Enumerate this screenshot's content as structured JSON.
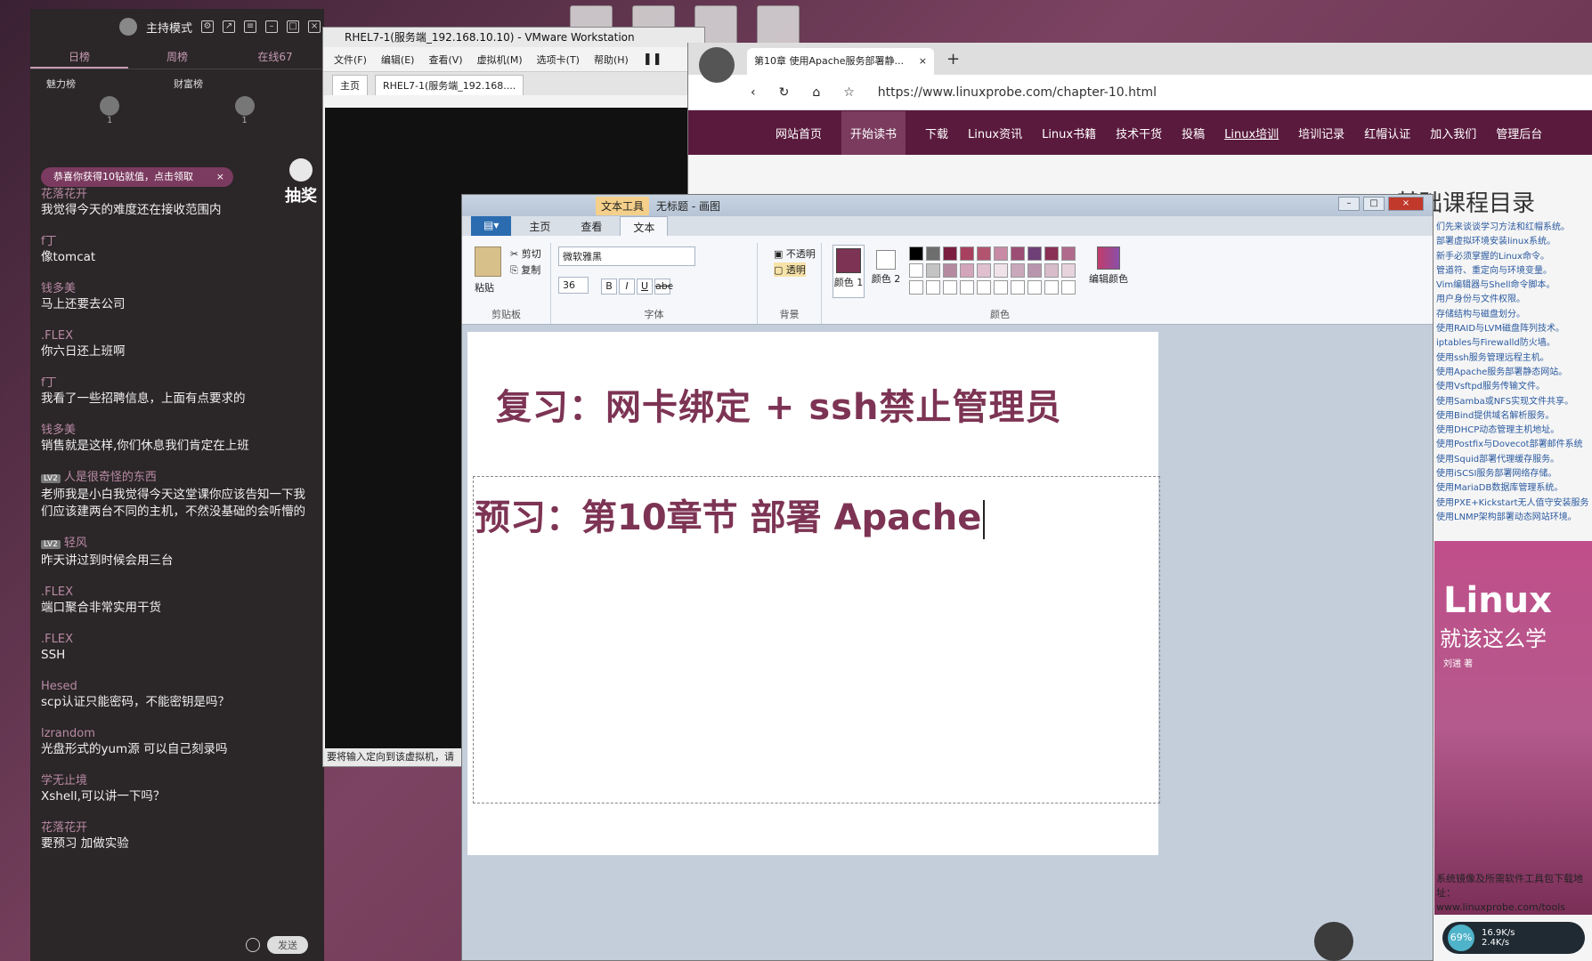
{
  "chat": {
    "mode_label": "主持模式",
    "tabs": [
      "日榜",
      "周榜",
      "在线67"
    ],
    "rank_labels": [
      "魅力榜",
      "财富榜"
    ],
    "rank_counts": [
      "1",
      "1"
    ],
    "gift_banner": "恭喜你获得10钻就值，点击领取",
    "lottery_label": "抽奖",
    "messages": [
      {
        "user": "花落花开",
        "text": "我觉得今天的难度还在接收范围内",
        "lv": ""
      },
      {
        "user": "f丁",
        "text": "像tomcat",
        "lv": ""
      },
      {
        "user": "钱多美",
        "text": "马上还要去公司",
        "lv": ""
      },
      {
        "user": ".FLEX",
        "text": "你六日还上班啊",
        "lv": ""
      },
      {
        "user": "f丁",
        "text": "我看了一些招聘信息，上面有点要求的",
        "lv": ""
      },
      {
        "user": "钱多美",
        "text": "销售就是这样,你们休息我们肯定在上班",
        "lv": ""
      },
      {
        "user": "人是很奇怪的东西",
        "text": "老师我是小白我觉得今天这堂课你应该告知一下我们应该建两台不同的主机，不然没基础的会听懵的",
        "lv": "LV2"
      },
      {
        "user": "轻风",
        "text": "昨天讲过到时候会用三台",
        "lv": "LV2"
      },
      {
        "user": ".FLEX",
        "text": "端口聚合非常实用干货",
        "lv": ""
      },
      {
        "user": ".FLEX",
        "text": "SSH",
        "lv": ""
      },
      {
        "user": "Hesed",
        "text": "scp认证只能密码，不能密钥是吗？",
        "lv": ""
      },
      {
        "user": "lzrandom",
        "text": "光盘形式的yum源 可以自己刻录吗",
        "lv": ""
      },
      {
        "user": "学无止境",
        "text": "Xshell,可以讲一下吗？",
        "lv": ""
      },
      {
        "user": "花落花开",
        "text": "要预习 加做实验",
        "lv": ""
      }
    ],
    "send_label": "发送"
  },
  "vmware": {
    "title": "RHEL7-1(服务端_192.168.10.10) - VMware Workstation",
    "menu": [
      "文件(F)",
      "编辑(E)",
      "查看(V)",
      "虚拟机(M)",
      "选项卡(T)",
      "帮助(H)"
    ],
    "tabs": [
      "主页",
      "RHEL7-1(服务端_192.168...."
    ],
    "status": "要将输入定向到该虚拟机，请"
  },
  "browser": {
    "tab_title": "第10章 使用Apache服务部署静...",
    "url": "https://www.linuxprobe.com/chapter-10.html",
    "nav": [
      "网站首页",
      "开始读书",
      "下载",
      "Linux资讯",
      "Linux书籍",
      "技术干货",
      "投稿",
      "Linux培训",
      "培训记录",
      "红帽认证",
      "加入我们",
      "管理后台"
    ],
    "course_title": "基础课程目录",
    "course_items": [
      "们先来谈谈学习方法和红帽系统。",
      "部署虚拟环境安装linux系统。",
      "新手必须掌握的Linux命令。",
      "管道符、重定向与环境变量。",
      "Vim编辑器与Shell命令脚本。",
      "用户身份与文件权限。",
      "存储结构与磁盘划分。",
      "使用RAID与LVM磁盘阵列技术。",
      "iptables与Firewalld防火墙。",
      "使用ssh服务管理远程主机。",
      "使用Apache服务部署静态网站。",
      "使用Vsftpd服务传输文件。",
      "使用Samba或NFS实现文件共享。",
      "使用Bind提供域名解析服务。",
      "使用DHCP动态管理主机地址。",
      "使用Postfix与Dovecot部署邮件系统",
      "使用Squid部署代理缓存服务。",
      "使用iSCSI服务部署网络存储。",
      "使用MariaDB数据库管理系统。",
      "使用PXE+Kickstart无人值守安装服务",
      "使用LNMP架构部署动态网站环境。"
    ],
    "book_title": "Linux",
    "book_subtitle": "就该这么学",
    "book_author": "刘遄 著",
    "footer_lines": [
      "系统镜像及所需软件工具包下载地址：",
      "www.linuxprobe.com/tools"
    ],
    "speed": {
      "percent": "69%",
      "up": "16.9K/s",
      "down": "2.4K/s"
    }
  },
  "paint": {
    "title": "无标题 - 画图",
    "context_tab": "文本工具",
    "tabs": [
      "主页",
      "查看",
      "文本"
    ],
    "clipboard": {
      "paste": "粘贴",
      "cut": "剪切",
      "copy": "复制",
      "label": "剪贴板"
    },
    "font": {
      "name": "微软雅黑",
      "size": "36",
      "label": "字体"
    },
    "background": {
      "opaque": "不透明",
      "transparent": "透明",
      "label": "背景"
    },
    "colors": {
      "color1": "颜色 1",
      "color2": "颜色 2",
      "edit": "编辑颜色",
      "label": "颜色"
    },
    "line1": "复习：网卡绑定     +     ssh禁止管理员",
    "line2": "预习：第10章节  部署 Apache"
  }
}
